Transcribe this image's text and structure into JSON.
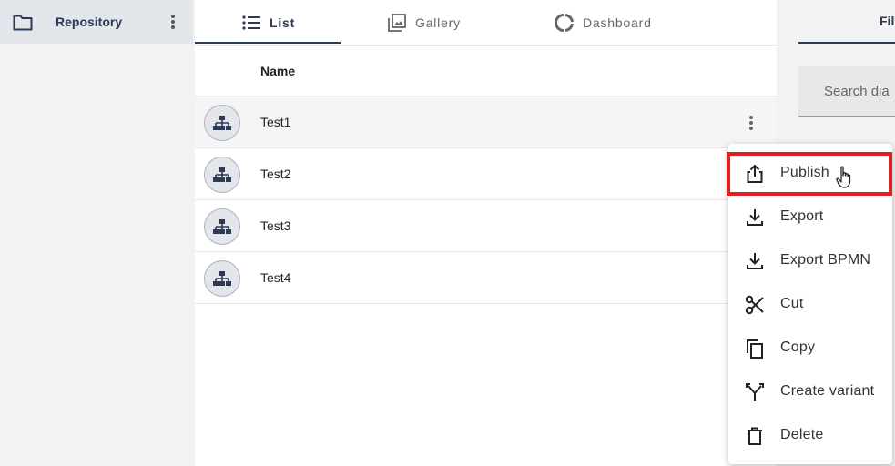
{
  "sidebar": {
    "repository_label": "Repository"
  },
  "tabs": [
    {
      "label": "List",
      "icon": "list-icon",
      "active": true
    },
    {
      "label": "Gallery",
      "icon": "gallery-icon",
      "active": false
    },
    {
      "label": "Dashboard",
      "icon": "dashboard-icon",
      "active": false
    }
  ],
  "table": {
    "column_name": "Name",
    "rows": [
      {
        "name": "Test1",
        "icon": "diagram-icon"
      },
      {
        "name": "Test2",
        "icon": "diagram-icon"
      },
      {
        "name": "Test3",
        "icon": "diagram-icon"
      },
      {
        "name": "Test4",
        "icon": "diagram-icon"
      }
    ]
  },
  "right_panel": {
    "tab_fragment": "Fil",
    "search_placeholder": "Search dia"
  },
  "context_menu": {
    "items": [
      {
        "label": "Publish",
        "icon": "publish-icon"
      },
      {
        "label": "Export",
        "icon": "download-icon"
      },
      {
        "label": "Export BPMN",
        "icon": "download-icon"
      },
      {
        "label": "Cut",
        "icon": "scissors-icon"
      },
      {
        "label": "Copy",
        "icon": "copy-icon"
      },
      {
        "label": "Create variant",
        "icon": "fork-icon"
      },
      {
        "label": "Delete",
        "icon": "trash-icon"
      }
    ]
  },
  "colors": {
    "accent": "#2b3a55",
    "highlight": "#e02020",
    "sidebar_bg": "#f2f2f2",
    "selected_bg": "#e3e6ea"
  }
}
